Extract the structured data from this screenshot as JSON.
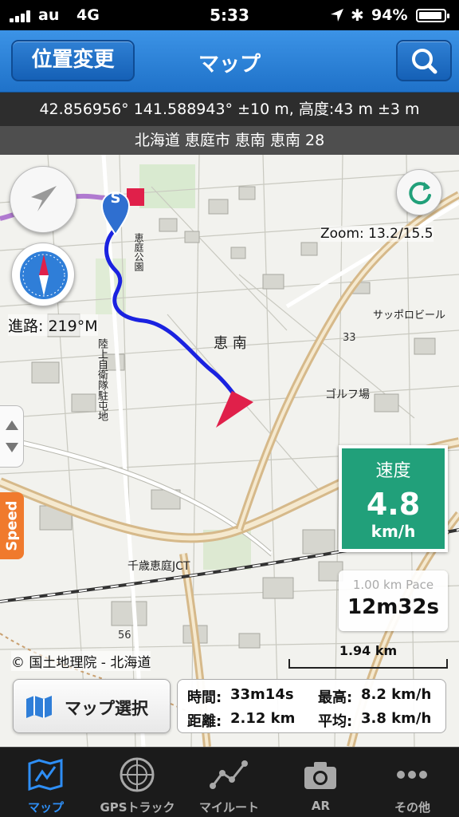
{
  "status_bar": {
    "carrier": "au",
    "network": "4G",
    "time": "5:33",
    "battery_text": "94%",
    "battery_level": 0.94
  },
  "nav": {
    "left_button": "位置変更",
    "title": "マップ",
    "right_icon": "search-icon"
  },
  "location": {
    "coords_text": "42.856956° 141.588943° ±10 m, 高度:43 m ±3 m",
    "address": "北海道 恵庭市 恵南 恵南 28"
  },
  "map": {
    "zoom_text": "Zoom: 13.2/15.5",
    "course_text": "進路: 219°M",
    "start_marker": "S",
    "speed_tab": "Speed",
    "speed_label": "速度",
    "speed_value": "4.8",
    "speed_unit": "km/h",
    "pace_label": "1.00 km Pace",
    "pace_value": "12m32s",
    "scale_text": "1.94 km",
    "copyright": "© 国土地理院 - 北海道",
    "map_labels": {
      "district": "恵 南",
      "golf": "ゴルフ場",
      "beer": "サッポロビール",
      "jct": "千歳恵庭JCT",
      "park": "恵庭公園",
      "camp": "陸上自衛隊駐屯地",
      "num_56": "56",
      "num_33": "33"
    },
    "colors": {
      "track": "#1a22e0",
      "heading_arrow": "#e0204a",
      "speed_box": "#21a07a",
      "route_highway": "#b07ad0"
    }
  },
  "bottom_panel": {
    "map_select_label": "マップ選択",
    "time_label": "時間:",
    "time_value": "33m14s",
    "max_label": "最高:",
    "max_value": "8.2 km/h",
    "distance_label": "距離:",
    "distance_value": "2.12 km",
    "avg_label": "平均:",
    "avg_value": "3.8 km/h"
  },
  "tabs": [
    {
      "label": "マップ",
      "icon": "map-icon",
      "active": true
    },
    {
      "label": "GPSトラック",
      "icon": "radar-icon",
      "active": false
    },
    {
      "label": "マイルート",
      "icon": "route-icon",
      "active": false
    },
    {
      "label": "AR",
      "icon": "camera-icon",
      "active": false
    },
    {
      "label": "その他",
      "icon": "more-icon",
      "active": false
    }
  ]
}
